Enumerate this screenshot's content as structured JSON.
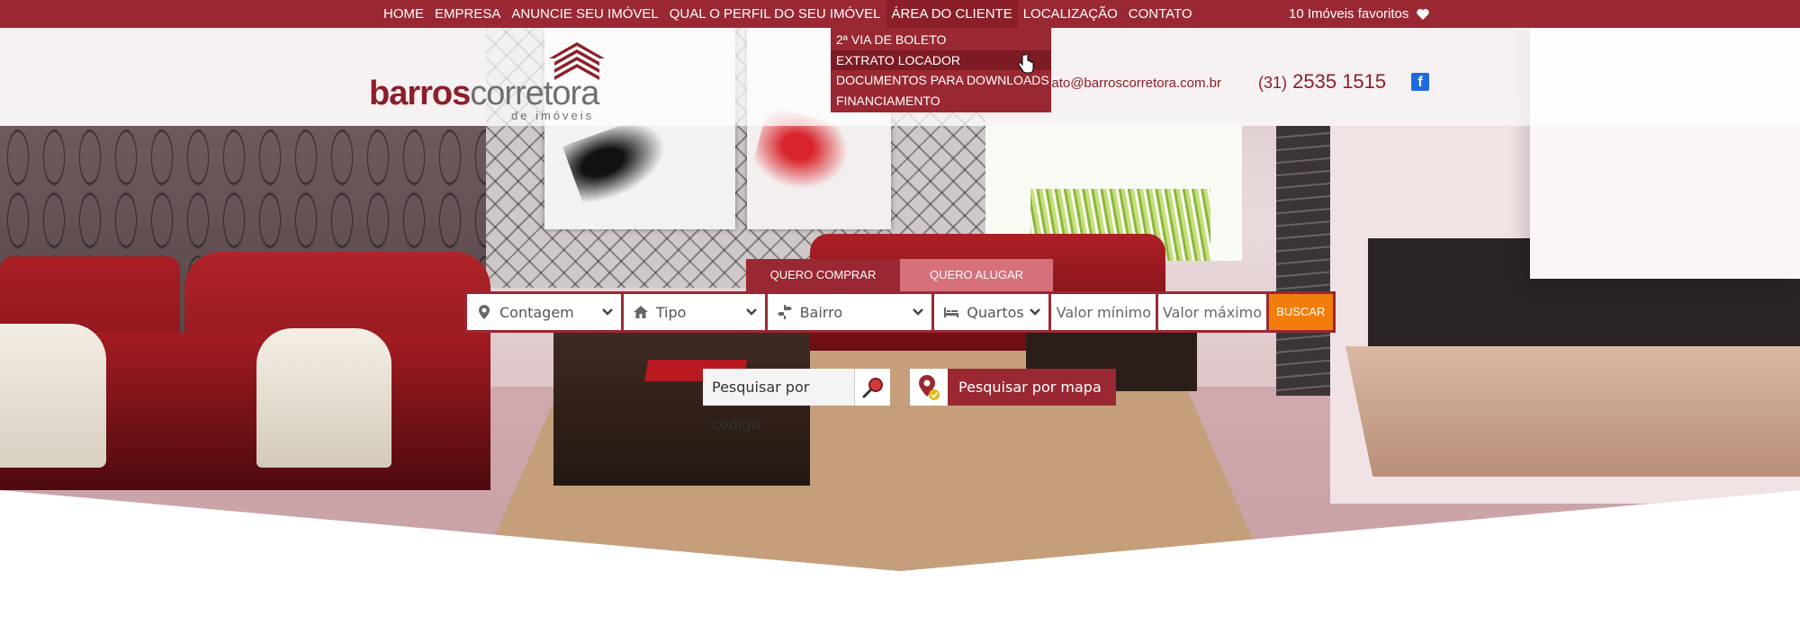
{
  "nav": {
    "items": [
      "HOME",
      "EMPRESA",
      "ANUNCIE SEU IMÓVEL",
      "QUAL O PERFIL DO SEU IMÓVEL",
      "ÁREA DO CLIENTE",
      "LOCALIZAÇÃO",
      "CONTATO"
    ],
    "active_index": 4,
    "favorites": "10 Imóveis favoritos"
  },
  "dropdown": {
    "items": [
      "2ª VIA DE BOLETO",
      "EXTRATO LOCADOR",
      "DOCUMENTOS PARA DOWNLOADS",
      "FINANCIAMENTO"
    ],
    "hover_index": 1
  },
  "logo": {
    "part1": "barros",
    "part2": "corretora",
    "sub": "de imóveis"
  },
  "contact": {
    "email": "contato@barroscorretora.com.br",
    "phone_prefix": "(31)",
    "phone": "2535 1515"
  },
  "search": {
    "tabs": [
      "QUERO COMPRAR",
      "QUERO ALUGAR"
    ],
    "fields": {
      "city": "Contagem",
      "type": "Tipo",
      "neighborhood": "Bairro",
      "rooms": "Quartos",
      "min_value": "Valor mínimo",
      "max_value": "Valor máximo"
    },
    "button": "BUSCAR",
    "code_search": "Pesquisar por código",
    "map_search": "Pesquisar por mapa"
  },
  "colors": {
    "brand": "#9a2832",
    "tab_inactive": "#d6707a",
    "search_button": "#f27d0c",
    "facebook": "#1e6be0"
  },
  "icons": {
    "favorites": "heart-icon",
    "social": "facebook-icon",
    "city": "map-pin-icon",
    "type": "home-icon",
    "neighborhood": "signpost-icon",
    "rooms": "bed-icon",
    "code_search": "magnifier-icon",
    "map_search": "map-marker-check-icon"
  }
}
